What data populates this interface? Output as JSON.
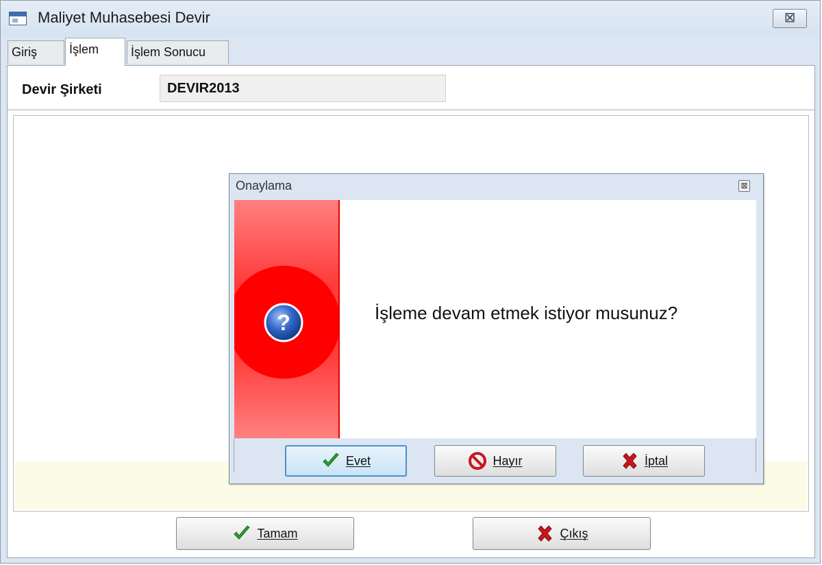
{
  "window": {
    "title": "Maliyet Muhasebesi Devir",
    "close_label": "⊠"
  },
  "tabs": [
    {
      "label": "Giriş"
    },
    {
      "label": "İşlem",
      "active": true
    },
    {
      "label": "İşlem Sonucu"
    }
  ],
  "form": {
    "company_label": "Devir Şirketi",
    "company_value": "DEVIR2013"
  },
  "footer": {
    "ok_label": "Tamam",
    "exit_label": "Çıkış"
  },
  "dialog": {
    "title": "Onaylama",
    "close_label": "⊠",
    "message": "İşleme devam etmek istiyor musunuz?",
    "yes_label": "Evet",
    "no_label": "Hayır",
    "cancel_label": "İptal"
  },
  "colors": {
    "accent": "#ff0000",
    "window_bg": "#dbe6f2",
    "info_strip": "#fcfbe6",
    "ok_check": "#2f9e2f",
    "cancel_x": "#c8171c"
  },
  "icons": {
    "question": "question-icon",
    "check": "check-icon",
    "stop": "stop-icon",
    "x": "x-icon",
    "app": "app-icon"
  }
}
